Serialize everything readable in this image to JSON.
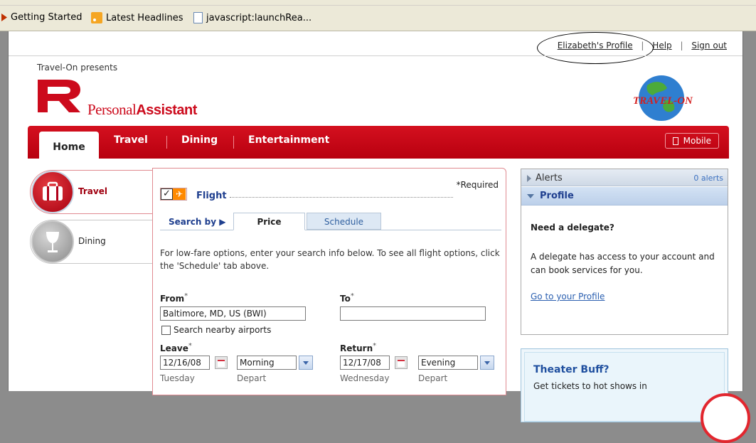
{
  "browser": {
    "bookmarks": [
      {
        "label": "Getting Started",
        "icon": "firefox-arrow-icon"
      },
      {
        "label": "Latest Headlines",
        "icon": "rss-icon"
      },
      {
        "label": "javascript:launchRea...",
        "icon": "page-icon"
      }
    ]
  },
  "header": {
    "links": {
      "profile": "Elizabeth's Profile",
      "help": "Help",
      "signout": "Sign out"
    },
    "presents": "Travel-On presents",
    "logo_light": "Personal",
    "logo_bold": "Assistant",
    "brand_color": "#cc0a1c",
    "partner_logo_text": "TRAVEL-ON"
  },
  "nav": {
    "tabs": [
      "Home",
      "Travel",
      "Dining",
      "Entertainment"
    ],
    "mobile": "Mobile"
  },
  "categories": {
    "travel": "Travel",
    "dining": "Dining"
  },
  "flight": {
    "label": "Flight",
    "required": "*Required",
    "search_by": "Search by",
    "tab_price": "Price",
    "tab_schedule": "Schedule",
    "intro": "For low-fare options, enter your search info below. To see all flight options, click the 'Schedule' tab above.",
    "from_label": "From",
    "from_value": "Baltimore, MD, US (BWI)",
    "to_label": "To",
    "to_value": "",
    "nearby_label": "Search nearby airports",
    "leave_label": "Leave",
    "leave_date": "12/16/08",
    "leave_day": "Tuesday",
    "leave_time": "Morning",
    "leave_time_sub": "Depart",
    "return_label": "Return",
    "return_date": "12/17/08",
    "return_day": "Wednesday",
    "return_time": "Evening",
    "return_time_sub": "Depart",
    "asterisk": "*"
  },
  "alerts": {
    "title": "Alerts",
    "count": "0 alerts"
  },
  "profile": {
    "title": "Profile",
    "delegate_title": "Need a delegate?",
    "delegate_text": "A delegate has access to your account and can book services for you.",
    "link": "Go to your Profile"
  },
  "promo": {
    "title": "Theater Buff?",
    "text": "Get tickets to hot shows in"
  }
}
